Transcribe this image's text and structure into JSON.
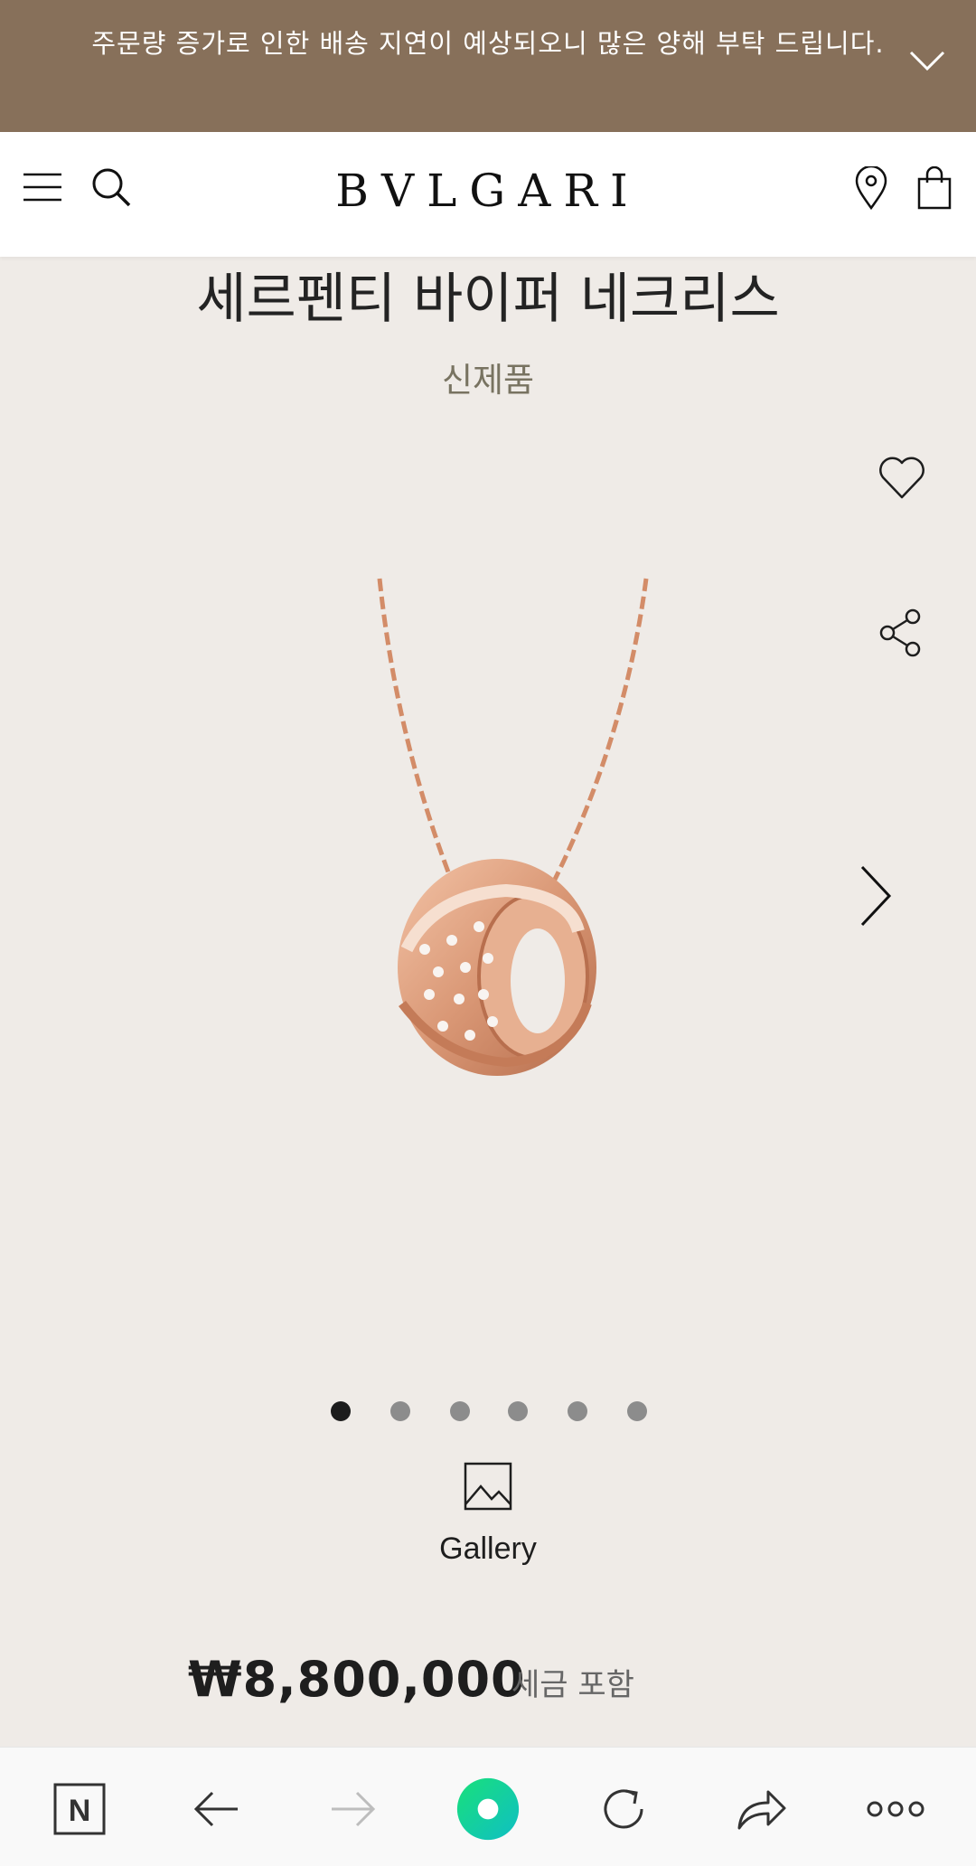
{
  "banner": {
    "text": "주문량 증가로 인한 배송 지연이 예상되오니 많은 양해 부탁 드립니다."
  },
  "header": {
    "logo": "BVLGARI"
  },
  "product": {
    "title": "세르펜티 바이퍼 네크리스",
    "badge": "신제품",
    "carousel_total": 6,
    "carousel_active": 1,
    "gallery_label": "Gallery",
    "price": "₩8,800,000",
    "tax_note": "세금 포함"
  },
  "icons": {
    "menu": "menu-icon",
    "search": "search-icon",
    "location": "location-pin-icon",
    "bag": "shopping-bag-icon",
    "wishlist": "heart-icon",
    "share": "share-icon",
    "next": "chevron-right-icon",
    "gallery": "image-icon"
  },
  "browser_bar": {
    "home": "N",
    "items": [
      "naver-home",
      "back",
      "forward",
      "green-dot",
      "reload",
      "share",
      "more"
    ]
  },
  "colors": {
    "banner": "#87705a",
    "page_bg": "#efebe7",
    "badge": "#787361",
    "accent_rose_gold": "#d99775",
    "green_dot": "#14d38e"
  }
}
